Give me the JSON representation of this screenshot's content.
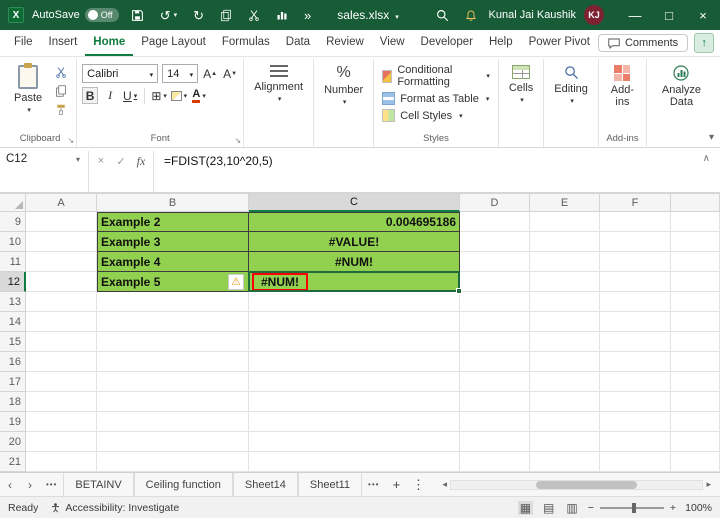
{
  "titlebar": {
    "autosave_label": "AutoSave",
    "autosave_state": "Off",
    "file_name": "sales.xlsx",
    "user_name": "Kunal Jai Kaushik",
    "user_initials": "KJ"
  },
  "icons": {
    "undo": "↺",
    "redo": "↻",
    "overflow": "»",
    "warning": "⚠",
    "borders": "⊞"
  },
  "menubar": {
    "tabs": [
      "File",
      "Insert",
      "Home",
      "Page Layout",
      "Formulas",
      "Data",
      "Review",
      "View",
      "Developer",
      "Help",
      "Power Pivot"
    ],
    "active_tab": "Home",
    "comments_label": "Comments"
  },
  "ribbon": {
    "paste": "Paste",
    "clipboard_group": "Clipboard",
    "font_name": "Calibri",
    "font_size": "14",
    "bold": "B",
    "italic": "I",
    "underline": "U",
    "font_group": "Font",
    "alignment": "Alignment",
    "number": "Number",
    "conditional_formatting": "Conditional Formatting",
    "format_as_table": "Format as Table",
    "cell_styles": "Cell Styles",
    "styles_group": "Styles",
    "cells": "Cells",
    "editing": "Editing",
    "addins": "Add-ins",
    "addins_group": "Add-ins",
    "analyze_data": "Analyze Data"
  },
  "formula_bar": {
    "cell_reference": "C12",
    "cancel_glyph": "×",
    "enter_glyph": "✓",
    "fx_label": "fx",
    "formula": "=FDIST(23,10^20,5)",
    "collapse_glyph": "∧"
  },
  "grid": {
    "columns": [
      "A",
      "B",
      "C",
      "D",
      "E",
      "F"
    ],
    "selected_column": "C",
    "selected_row": 12,
    "first_row": 9,
    "last_row": 21,
    "fill_color": "#92d050",
    "cells": [
      {
        "row": 9,
        "col": "B",
        "text": "Example 2",
        "fill": true
      },
      {
        "row": 9,
        "col": "C",
        "text": "0.004695186",
        "fill": true,
        "align": "right"
      },
      {
        "row": 10,
        "col": "B",
        "text": "Example 3",
        "fill": true
      },
      {
        "row": 10,
        "col": "C",
        "text": "#VALUE!",
        "fill": true,
        "align": "center"
      },
      {
        "row": 11,
        "col": "B",
        "text": "Example 4",
        "fill": true
      },
      {
        "row": 11,
        "col": "C",
        "text": "#NUM!",
        "fill": true,
        "align": "center"
      },
      {
        "row": 12,
        "col": "B",
        "text": "Example 5",
        "fill": true,
        "warning": true
      },
      {
        "row": 12,
        "col": "C",
        "text": "#NUM!",
        "fill": true,
        "align": "center",
        "red_box": true,
        "active": true
      }
    ]
  },
  "sheet_bar": {
    "prev": "‹",
    "next": "›",
    "ellipsis": "•••",
    "tabs": [
      "BETAINV",
      "Ceiling function",
      "Sheet14",
      "Sheet11"
    ],
    "add": "+",
    "more": "⋮"
  },
  "status_bar": {
    "mode": "Ready",
    "accessibility": "Accessibility: Investigate",
    "zoom_out": "−",
    "zoom_in": "+",
    "zoom": "100%"
  }
}
